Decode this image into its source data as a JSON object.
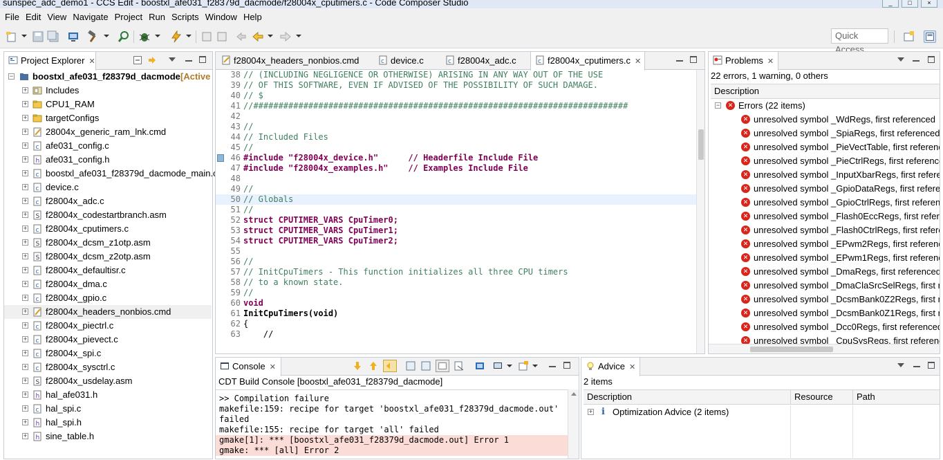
{
  "window": {
    "title": "sunspec_adc_demo1 - CCS Edit - boostxl_afe031_f28379d_dacmode/f28004x_cputimers.c - Code Composer Studio"
  },
  "menu": [
    "File",
    "Edit",
    "View",
    "Navigate",
    "Project",
    "Run",
    "Scripts",
    "Window",
    "Help"
  ],
  "toolbar": {
    "quick_access": "Quick Access"
  },
  "explorer": {
    "tab_label": "Project Explorer",
    "project": "boostxl_afe031_f28379d_dacmode",
    "project_status": "[Active",
    "items": [
      {
        "label": "Includes",
        "icon": "includes-icon"
      },
      {
        "label": "CPU1_RAM",
        "icon": "folder-icon"
      },
      {
        "label": "targetConfigs",
        "icon": "folder-icon"
      },
      {
        "label": "28004x_generic_ram_lnk.cmd",
        "icon": "cmd-file-icon"
      },
      {
        "label": "afe031_config.c",
        "icon": "c-file-icon"
      },
      {
        "label": "afe031_config.h",
        "icon": "h-file-icon"
      },
      {
        "label": "boostxl_afe031_f28379d_dacmode_main.c",
        "icon": "c-file-icon"
      },
      {
        "label": "device.c",
        "icon": "c-file-icon"
      },
      {
        "label": "f28004x_adc.c",
        "icon": "c-file-icon"
      },
      {
        "label": "f28004x_codestartbranch.asm",
        "icon": "asm-file-icon"
      },
      {
        "label": "f28004x_cputimers.c",
        "icon": "c-file-icon"
      },
      {
        "label": "f28004x_dcsm_z1otp.asm",
        "icon": "asm-file-icon"
      },
      {
        "label": "f28004x_dcsm_z2otp.asm",
        "icon": "asm-file-icon"
      },
      {
        "label": "f28004x_defaultisr.c",
        "icon": "c-file-icon"
      },
      {
        "label": "f28004x_dma.c",
        "icon": "c-file-icon"
      },
      {
        "label": "f28004x_gpio.c",
        "icon": "c-file-icon"
      },
      {
        "label": "f28004x_headers_nonbios.cmd",
        "icon": "cmd-file-icon"
      },
      {
        "label": "f28004x_piectrl.c",
        "icon": "c-file-icon"
      },
      {
        "label": "f28004x_pievect.c",
        "icon": "c-file-icon"
      },
      {
        "label": "f28004x_spi.c",
        "icon": "c-file-icon"
      },
      {
        "label": "f28004x_sysctrl.c",
        "icon": "c-file-icon"
      },
      {
        "label": "f28004x_usdelay.asm",
        "icon": "asm-file-icon"
      },
      {
        "label": "hal_afe031.h",
        "icon": "h-file-icon"
      },
      {
        "label": "hal_spi.c",
        "icon": "c-file-icon"
      },
      {
        "label": "hal_spi.h",
        "icon": "h-file-icon"
      },
      {
        "label": "sine_table.h",
        "icon": "h-file-icon"
      }
    ]
  },
  "editor": {
    "tabs": [
      {
        "label": "f28004x_headers_nonbios.cmd",
        "icon": "cmd-file-icon"
      },
      {
        "label": "device.c",
        "icon": "c-file-icon"
      },
      {
        "label": "f28004x_adc.c",
        "icon": "c-file-icon"
      },
      {
        "label": "f28004x_cputimers.c",
        "icon": "c-file-icon",
        "active": true
      }
    ],
    "lines": [
      {
        "n": "38",
        "t": "// (INCLUDING NEGLIGENCE OR OTHERWISE) ARISING IN ANY WAY OUT OF THE USE"
      },
      {
        "n": "39",
        "t": "// OF THIS SOFTWARE, EVEN IF ADVISED OF THE POSSIBILITY OF SUCH DAMAGE."
      },
      {
        "n": "40",
        "t": "// $"
      },
      {
        "n": "41",
        "t": "//###########################################################################"
      },
      {
        "n": "42",
        "t": ""
      },
      {
        "n": "43",
        "t": "//"
      },
      {
        "n": "44",
        "t": "// Included Files"
      },
      {
        "n": "45",
        "t": "//"
      },
      {
        "n": "46",
        "t": "#include \"f28004x_device.h\"      // Headerfile Include File"
      },
      {
        "n": "47",
        "t": "#include \"f28004x_examples.h\"    // Examples Include File"
      },
      {
        "n": "48",
        "t": ""
      },
      {
        "n": "49",
        "t": "//"
      },
      {
        "n": "50",
        "t": "// Globals"
      },
      {
        "n": "51",
        "t": "//"
      },
      {
        "n": "52",
        "t": "struct CPUTIMER_VARS CpuTimer0;"
      },
      {
        "n": "53",
        "t": "struct CPUTIMER_VARS CpuTimer1;"
      },
      {
        "n": "54",
        "t": "struct CPUTIMER_VARS CpuTimer2;"
      },
      {
        "n": "55",
        "t": ""
      },
      {
        "n": "56",
        "t": "//"
      },
      {
        "n": "57",
        "t": "// InitCpuTimers - This function initializes all three CPU timers"
      },
      {
        "n": "58",
        "t": "// to a known state."
      },
      {
        "n": "59",
        "t": "//"
      },
      {
        "n": "60",
        "t": "void"
      },
      {
        "n": "61",
        "t": "InitCpuTimers(void)"
      },
      {
        "n": "62",
        "t": "{"
      },
      {
        "n": "63",
        "t": "    //"
      }
    ]
  },
  "problems": {
    "tab_label": "Problems",
    "summary": "22 errors, 1 warning, 0 others",
    "column": "Description",
    "group": "Errors (22 items)",
    "items": [
      "unresolved symbol _WdRegs, first referenced",
      "unresolved symbol _SpiaRegs, first referenced",
      "unresolved symbol _PieVectTable, first referenced",
      "unresolved symbol _PieCtrlRegs, first referenced",
      "unresolved symbol _InputXbarRegs, first referenced",
      "unresolved symbol _GpioDataRegs, first referenced",
      "unresolved symbol _GpioCtrlRegs, first referenced",
      "unresolved symbol _Flash0EccRegs, first referenced",
      "unresolved symbol _Flash0CtrlRegs, first referenced",
      "unresolved symbol _EPwm2Regs, first referenced",
      "unresolved symbol _EPwm1Regs, first referenced",
      "unresolved symbol _DmaRegs, first referenced",
      "unresolved symbol _DmaClaSrcSelRegs, first referenced",
      "unresolved symbol _DcsmBank0Z2Regs, first referenced",
      "unresolved symbol _DcsmBank0Z1Regs, first referenced",
      "unresolved symbol _Dcc0Regs, first referenced",
      "unresolved symbol _CpuSysRegs, first referenced"
    ]
  },
  "console": {
    "tab_label": "Console",
    "subtitle": "CDT Build Console [boostxl_afe031_f28379d_dacmode]",
    "lines": [
      {
        "t": ">> Compilation failure",
        "err": false
      },
      {
        "t": "makefile:159: recipe for target 'boostxl_afe031_f28379d_dacmode.out'",
        "err": false
      },
      {
        "t": "failed",
        "err": false
      },
      {
        "t": "makefile:155: recipe for target 'all' failed",
        "err": false
      },
      {
        "t": "gmake[1]: *** [boostxl_afe031_f28379d_dacmode.out] Error 1",
        "err": true
      },
      {
        "t": "gmake: *** [all] Error 2",
        "err": true
      }
    ]
  },
  "advice": {
    "tab_label": "Advice",
    "subtitle": "2 items",
    "columns": [
      "Description",
      "Resource",
      "Path"
    ],
    "row": "Optimization Advice (2 items)"
  },
  "colors": {
    "error": "#d9261c",
    "console_error_bg": "#fbdcd6",
    "comment": "#3f7f5f",
    "keyword": "#7f0055",
    "string": "#2a00ff"
  }
}
